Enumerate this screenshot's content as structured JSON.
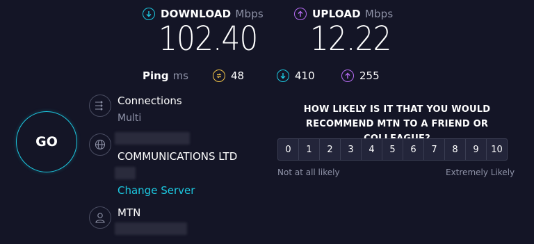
{
  "download": {
    "label": "DOWNLOAD",
    "unit": "Mbps",
    "value": "102.40",
    "color": "#1cc8e0"
  },
  "upload": {
    "label": "UPLOAD",
    "unit": "Mbps",
    "value": "12.22",
    "color": "#b76cf5"
  },
  "ping": {
    "label": "Ping",
    "unit": "ms",
    "idle": "48",
    "download": "410",
    "upload": "255",
    "idle_color": "#f3c548"
  },
  "go_button": {
    "label": "GO",
    "color": "#1cc8e0"
  },
  "connections": {
    "title": "Connections",
    "mode": "Multi",
    "icon": "connections-arrows-icon"
  },
  "server": {
    "isp_name": "COMMUNICATIONS LTD",
    "change_label": "Change Server",
    "icon": "globe-icon"
  },
  "provider": {
    "name": "MTN",
    "icon": "user-icon"
  },
  "survey": {
    "question_line1": "HOW LIKELY IS IT THAT YOU WOULD",
    "question_line2": "RECOMMEND MTN TO A FRIEND OR COLLEAGUE?",
    "scale": [
      "0",
      "1",
      "2",
      "3",
      "4",
      "5",
      "6",
      "7",
      "8",
      "9",
      "10"
    ],
    "low_label": "Not at all likely",
    "high_label": "Extremely Likely"
  }
}
